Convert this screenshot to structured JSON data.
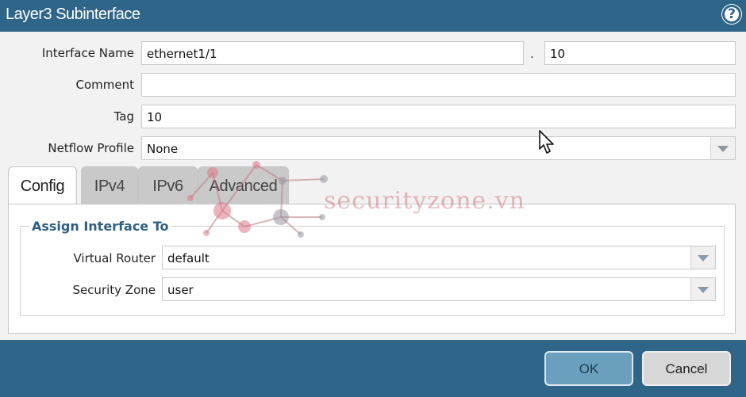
{
  "dialog": {
    "title": "Layer3 Subinterface",
    "help_icon": "help-circle-icon",
    "help_glyph": "?"
  },
  "form": {
    "interface_name_label": "Interface Name",
    "interface_name_value": "ethernet1/1",
    "separator": ".",
    "subinterface_number": "10",
    "comment_label": "Comment",
    "comment_value": "",
    "tag_label": "Tag",
    "tag_value": "10",
    "netflow_label": "Netflow Profile",
    "netflow_value": "None"
  },
  "tabs": [
    {
      "label": "Config",
      "active": true
    },
    {
      "label": "IPv4",
      "active": false
    },
    {
      "label": "IPv6",
      "active": false
    },
    {
      "label": "Advanced",
      "active": false
    }
  ],
  "assign": {
    "legend": "Assign Interface To",
    "virtual_router_label": "Virtual Router",
    "virtual_router_value": "default",
    "security_zone_label": "Security Zone",
    "security_zone_value": "user"
  },
  "buttons": {
    "ok_label": "OK",
    "cancel_label": "Cancel"
  },
  "watermark": {
    "text": "securityzone.vn"
  },
  "colors": {
    "titlebar": "#2e6588",
    "accent_text": "#2e5f82",
    "ok_button": "#6aa0bd",
    "cancel_button": "#d7d7d7"
  }
}
